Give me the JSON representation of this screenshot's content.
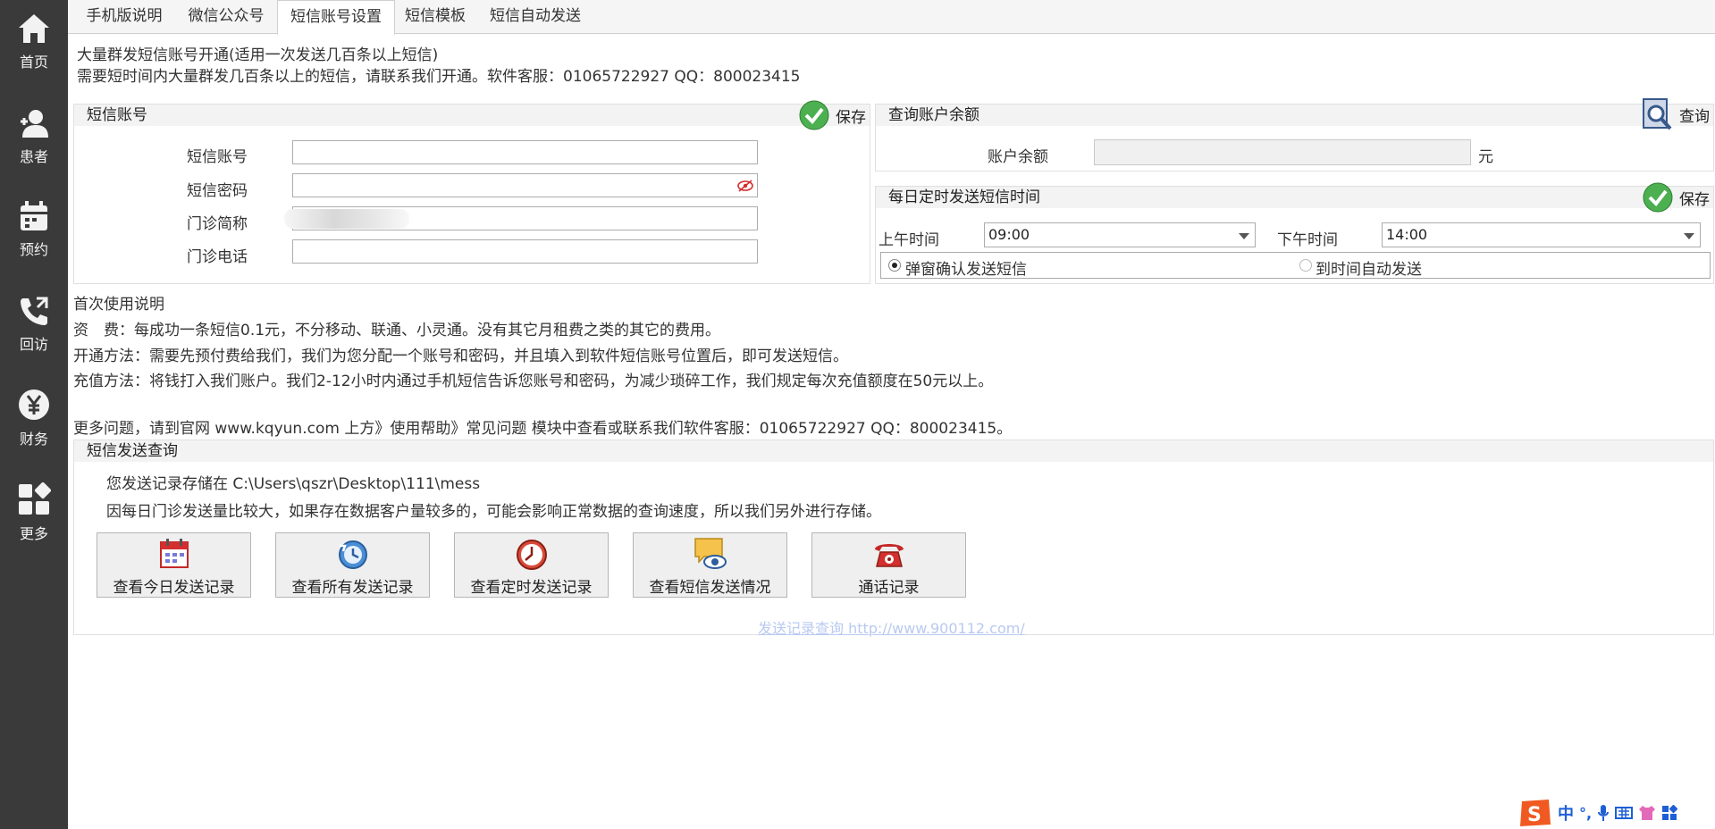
{
  "sidebar": {
    "items": [
      {
        "label": "首页",
        "icon": "home-icon"
      },
      {
        "label": "患者",
        "icon": "patient-icon"
      },
      {
        "label": "预约",
        "icon": "calendar-icon"
      },
      {
        "label": "回访",
        "icon": "phone-icon"
      },
      {
        "label": "财务",
        "icon": "yen-icon"
      },
      {
        "label": "更多",
        "icon": "more-grid-icon"
      }
    ]
  },
  "tabs": [
    "手机版说明",
    "微信公众号",
    "短信账号设置",
    "短信模板",
    "短信自动发送"
  ],
  "intro": {
    "line1": "大量群发短信账号开通(适用一次发送几百条以上短信)",
    "line2": "需要短时间内大量群发几百条以上的短信，请联系我们开通。软件客服：01065722927 QQ：800023415"
  },
  "account_panel": {
    "title": "短信账号",
    "save": "保存",
    "fields": [
      {
        "label": "短信账号",
        "value": ""
      },
      {
        "label": "短信密码",
        "value": ""
      },
      {
        "label": "门诊简称",
        "value": ""
      },
      {
        "label": "门诊电话",
        "value": ""
      }
    ]
  },
  "balance_panel": {
    "title": "查询账户余额",
    "query": "查询",
    "label": "账户余额",
    "value": "",
    "unit": "元"
  },
  "schedule_panel": {
    "title": "每日定时发送短信时间",
    "save": "保存",
    "am_label": "上午时间",
    "am_value": "09:00",
    "pm_label": "下午时间",
    "pm_value": "14:00",
    "option1": "弹窗确认发送短信",
    "option2": "到时间自动发送",
    "selected": "option1"
  },
  "instructions": {
    "title": "首次使用说明",
    "fee": "资　费：每成功一条短信0.1元，不分移动、联通、小灵通。没有其它月租费之类的其它的费用。",
    "open": "开通方法：需要先预付费给我们，我们为您分配一个账号和密码，并且填入到软件短信账号位置后，即可发送短信。",
    "recharge": "充值方法：将钱打入我们账户。我们2-12小时内通过手机短信告诉您账号和密码，为减少琐碎工作，我们规定每次充值额度在50元以上。",
    "more": "更多问题，请到官网 www.kqyun.com 上方》使用帮助》常见问题 模块中查看或联系我们软件客服：01065722927 QQ：800023415。"
  },
  "query_panel": {
    "title": "短信发送查询",
    "path_line": "您发送记录存储在 C:\\Users\\qszr\\Desktop\\111\\mess",
    "note": "因每日门诊发送量比较大，如果存在数据客户量较多的，可能会影响正常数据的查询速度，所以我们另外进行存储。",
    "buttons": [
      "查看今日发送记录",
      "查看所有发送记录",
      "查看定时发送记录",
      "查看短信发送情况",
      "通话记录"
    ],
    "link": "发送记录查询 http://www.900112.com/"
  },
  "tray": {
    "ime": "中",
    "punct": "°,"
  },
  "colors": {
    "sidebar": "#3a3a3a",
    "link": "#b9c9f0",
    "check": "#4caf50"
  }
}
